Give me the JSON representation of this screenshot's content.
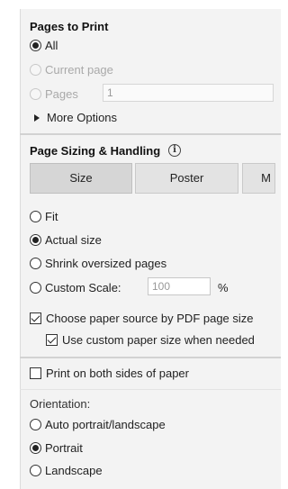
{
  "pages_to_print": {
    "heading": "Pages to Print",
    "options": [
      {
        "label": "All",
        "selected": true,
        "enabled": true
      },
      {
        "label": "Current page",
        "selected": false,
        "enabled": false
      },
      {
        "label": "Pages",
        "selected": false,
        "enabled": false
      }
    ],
    "pages_value": "1",
    "more_options": "More Options"
  },
  "page_sizing": {
    "heading": "Page Sizing & Handling",
    "info_glyph": "i",
    "tabs": [
      "Size",
      "Poster",
      "M"
    ],
    "scale_options": [
      {
        "label": "Fit",
        "selected": false
      },
      {
        "label": "Actual size",
        "selected": true
      },
      {
        "label": "Shrink oversized pages",
        "selected": false
      },
      {
        "label": "Custom Scale:",
        "selected": false
      }
    ],
    "custom_scale_value": "100",
    "custom_scale_unit": "%",
    "paper_source_label": "Choose paper source by PDF page size",
    "paper_source_checked": true,
    "custom_paper_label": "Use custom paper size when needed",
    "custom_paper_checked": true
  },
  "duplex": {
    "label": "Print on both sides of paper",
    "checked": false
  },
  "orientation": {
    "heading": "Orientation:",
    "options": [
      {
        "label": "Auto portrait/landscape",
        "selected": false
      },
      {
        "label": "Portrait",
        "selected": true
      },
      {
        "label": "Landscape",
        "selected": false
      }
    ]
  }
}
